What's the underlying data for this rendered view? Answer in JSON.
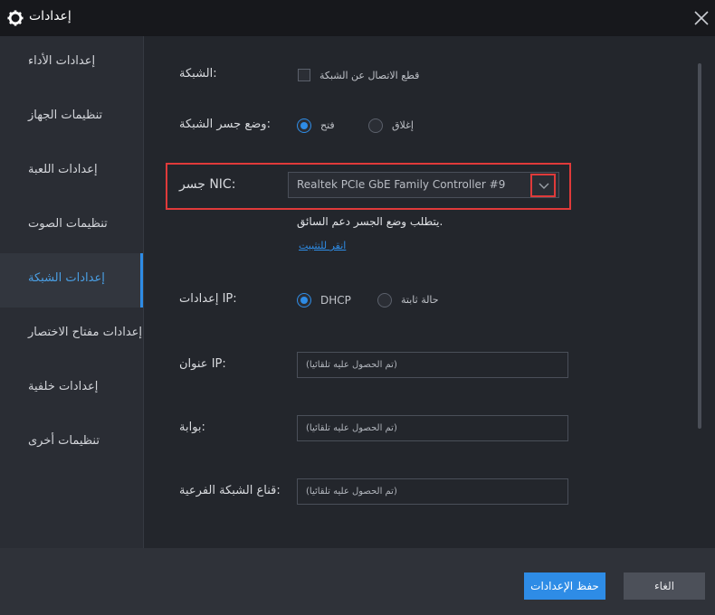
{
  "window": {
    "title": "إعدادات"
  },
  "sidebar": {
    "items": [
      {
        "label": "إعدادات الأداء"
      },
      {
        "label": "تنظيمات الجهاز"
      },
      {
        "label": "إعدادات اللعبة"
      },
      {
        "label": "تنظيمات الصوت"
      },
      {
        "label": "إعدادات الشبكة"
      },
      {
        "label": "إعدادات مفتاح الاختصار"
      },
      {
        "label": "إعدادات خلفية"
      },
      {
        "label": "تنظيمات أخرى"
      }
    ]
  },
  "network": {
    "label": "الشبكة:",
    "disconnect_label": "قطع الاتصال عن الشبكة",
    "disconnect_checked": false
  },
  "bridge_mode": {
    "label": "وضع جسر الشبكة:",
    "open_label": "فتح",
    "close_label": "إغلاق",
    "selected": "open"
  },
  "nic": {
    "label": "جسر NIC:",
    "value": "Realtek PCIe GbE Family Controller #9",
    "note": "يتطلب وضع الجسر دعم السائق.",
    "install_link": "انقر للتثبيت"
  },
  "ip_settings": {
    "label": "إعدادات IP:",
    "dhcp_label": "DHCP",
    "static_label": "حالة ثابتة",
    "selected": "dhcp"
  },
  "ip_address": {
    "label": "عنوان IP:",
    "placeholder": "(تم الحصول عليه تلقائياً)"
  },
  "gateway": {
    "label": "بوابة:",
    "placeholder": "(تم الحصول عليه تلقائياً)"
  },
  "subnet_mask": {
    "label": "قناع الشبكة الفرعية:",
    "placeholder": "(تم الحصول عليه تلقائياً)"
  },
  "footer": {
    "save_label": "حفظ الإعدادات",
    "cancel_label": "الغاء"
  },
  "colors": {
    "accent": "#2e8ce6",
    "highlight": "#e03a3a",
    "background": "#23262c",
    "sidebar": "#2a2d34"
  },
  "icons": {
    "title": "gear-icon",
    "close": "close-icon",
    "dropdown": "chevron-down-icon"
  }
}
